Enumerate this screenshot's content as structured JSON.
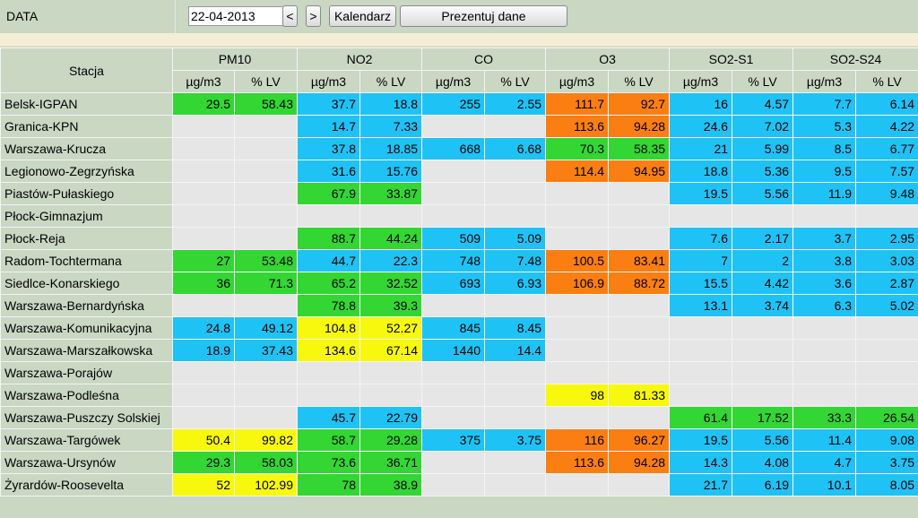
{
  "toolbar": {
    "date_label": "DATA",
    "date_value": "22-04-2013",
    "prev_label": "<",
    "next_label": ">",
    "calendar_label": "Kalendarz",
    "present_label": "Prezentuj dane"
  },
  "colors": {
    "green": "#33d633",
    "blue": "#1fc2f5",
    "yellow": "#f8f80f",
    "orange": "#fa7e12",
    "empty": "#e6e6e6",
    "header": "#c9d7c3"
  },
  "table": {
    "station_header": "Stacja",
    "pollutants": [
      "PM10",
      "NO2",
      "CO",
      "O3",
      "SO2-S1",
      "SO2-S24"
    ],
    "sub_headers": [
      "µg/m3",
      "% LV"
    ],
    "rows": [
      {
        "station": "Belsk-IGPAN",
        "cells": [
          [
            "29.5",
            "58.43",
            "green"
          ],
          [
            "37.7",
            "18.8",
            "blue"
          ],
          [
            "255",
            "2.55",
            "blue"
          ],
          [
            "111.7",
            "92.7",
            "orange"
          ],
          [
            "16",
            "4.57",
            "blue"
          ],
          [
            "7.7",
            "6.14",
            "blue"
          ]
        ]
      },
      {
        "station": "Granica-KPN",
        "cells": [
          [
            "",
            "",
            "empty"
          ],
          [
            "14.7",
            "7.33",
            "blue"
          ],
          [
            "",
            "",
            "empty"
          ],
          [
            "113.6",
            "94.28",
            "orange"
          ],
          [
            "24.6",
            "7.02",
            "blue"
          ],
          [
            "5.3",
            "4.22",
            "blue"
          ]
        ]
      },
      {
        "station": "Warszawa-Krucza",
        "cells": [
          [
            "",
            "",
            "empty"
          ],
          [
            "37.8",
            "18.85",
            "blue"
          ],
          [
            "668",
            "6.68",
            "blue"
          ],
          [
            "70.3",
            "58.35",
            "green"
          ],
          [
            "21",
            "5.99",
            "blue"
          ],
          [
            "8.5",
            "6.77",
            "blue"
          ]
        ]
      },
      {
        "station": "Legionowo-Zegrzyńska",
        "cells": [
          [
            "",
            "",
            "empty"
          ],
          [
            "31.6",
            "15.76",
            "blue"
          ],
          [
            "",
            "",
            "empty"
          ],
          [
            "114.4",
            "94.95",
            "orange"
          ],
          [
            "18.8",
            "5.36",
            "blue"
          ],
          [
            "9.5",
            "7.57",
            "blue"
          ]
        ]
      },
      {
        "station": "Piastów-Pułaskiego",
        "cells": [
          [
            "",
            "",
            "empty"
          ],
          [
            "67.9",
            "33.87",
            "green"
          ],
          [
            "",
            "",
            "empty"
          ],
          [
            "",
            "",
            "empty"
          ],
          [
            "19.5",
            "5.56",
            "blue"
          ],
          [
            "11.9",
            "9.48",
            "blue"
          ]
        ]
      },
      {
        "station": "Płock-Gimnazjum",
        "cells": [
          [
            "",
            "",
            "empty"
          ],
          [
            "",
            "",
            "empty"
          ],
          [
            "",
            "",
            "empty"
          ],
          [
            "",
            "",
            "empty"
          ],
          [
            "",
            "",
            "empty"
          ],
          [
            "",
            "",
            "empty"
          ]
        ]
      },
      {
        "station": "Płock-Reja",
        "cells": [
          [
            "",
            "",
            "empty"
          ],
          [
            "88.7",
            "44.24",
            "green"
          ],
          [
            "509",
            "5.09",
            "blue"
          ],
          [
            "",
            "",
            "empty"
          ],
          [
            "7.6",
            "2.17",
            "blue"
          ],
          [
            "3.7",
            "2.95",
            "blue"
          ]
        ]
      },
      {
        "station": "Radom-Tochtermana",
        "cells": [
          [
            "27",
            "53.48",
            "green"
          ],
          [
            "44.7",
            "22.3",
            "blue"
          ],
          [
            "748",
            "7.48",
            "blue"
          ],
          [
            "100.5",
            "83.41",
            "orange"
          ],
          [
            "7",
            "2",
            "blue"
          ],
          [
            "3.8",
            "3.03",
            "blue"
          ]
        ]
      },
      {
        "station": "Siedlce-Konarskiego",
        "cells": [
          [
            "36",
            "71.3",
            "green"
          ],
          [
            "65.2",
            "32.52",
            "green"
          ],
          [
            "693",
            "6.93",
            "blue"
          ],
          [
            "106.9",
            "88.72",
            "orange"
          ],
          [
            "15.5",
            "4.42",
            "blue"
          ],
          [
            "3.6",
            "2.87",
            "blue"
          ]
        ]
      },
      {
        "station": "Warszawa-Bernardyńska",
        "cells": [
          [
            "",
            "",
            "empty"
          ],
          [
            "78.8",
            "39.3",
            "green"
          ],
          [
            "",
            "",
            "empty"
          ],
          [
            "",
            "",
            "empty"
          ],
          [
            "13.1",
            "3.74",
            "blue"
          ],
          [
            "6.3",
            "5.02",
            "blue"
          ]
        ]
      },
      {
        "station": "Warszawa-Komunikacyjna",
        "cells": [
          [
            "24.8",
            "49.12",
            "blue"
          ],
          [
            "104.8",
            "52.27",
            "yellow"
          ],
          [
            "845",
            "8.45",
            "blue"
          ],
          [
            "",
            "",
            "empty"
          ],
          [
            "",
            "",
            "empty"
          ],
          [
            "",
            "",
            "empty"
          ]
        ]
      },
      {
        "station": "Warszawa-Marszałkowska",
        "cells": [
          [
            "18.9",
            "37.43",
            "blue"
          ],
          [
            "134.6",
            "67.14",
            "yellow"
          ],
          [
            "1440",
            "14.4",
            "blue"
          ],
          [
            "",
            "",
            "empty"
          ],
          [
            "",
            "",
            "empty"
          ],
          [
            "",
            "",
            "empty"
          ]
        ]
      },
      {
        "station": "Warszawa-Porajów",
        "cells": [
          [
            "",
            "",
            "empty"
          ],
          [
            "",
            "",
            "empty"
          ],
          [
            "",
            "",
            "empty"
          ],
          [
            "",
            "",
            "empty"
          ],
          [
            "",
            "",
            "empty"
          ],
          [
            "",
            "",
            "empty"
          ]
        ]
      },
      {
        "station": "Warszawa-Podleśna",
        "cells": [
          [
            "",
            "",
            "empty"
          ],
          [
            "",
            "",
            "empty"
          ],
          [
            "",
            "",
            "empty"
          ],
          [
            "98",
            "81.33",
            "yellow"
          ],
          [
            "",
            "",
            "empty"
          ],
          [
            "",
            "",
            "empty"
          ]
        ]
      },
      {
        "station": "Warszawa-Puszczy Solskiej",
        "cells": [
          [
            "",
            "",
            "empty"
          ],
          [
            "45.7",
            "22.79",
            "blue"
          ],
          [
            "",
            "",
            "empty"
          ],
          [
            "",
            "",
            "empty"
          ],
          [
            "61.4",
            "17.52",
            "green"
          ],
          [
            "33.3",
            "26.54",
            "green"
          ]
        ]
      },
      {
        "station": "Warszawa-Targówek",
        "cells": [
          [
            "50.4",
            "99.82",
            "yellow"
          ],
          [
            "58.7",
            "29.28",
            "green"
          ],
          [
            "375",
            "3.75",
            "blue"
          ],
          [
            "116",
            "96.27",
            "orange"
          ],
          [
            "19.5",
            "5.56",
            "blue"
          ],
          [
            "11.4",
            "9.08",
            "blue"
          ]
        ]
      },
      {
        "station": "Warszawa-Ursynów",
        "cells": [
          [
            "29.3",
            "58.03",
            "green"
          ],
          [
            "73.6",
            "36.71",
            "green"
          ],
          [
            "",
            "",
            "empty"
          ],
          [
            "113.6",
            "94.28",
            "orange"
          ],
          [
            "14.3",
            "4.08",
            "blue"
          ],
          [
            "4.7",
            "3.75",
            "blue"
          ]
        ]
      },
      {
        "station": "Żyrardów-Roosevelta",
        "cells": [
          [
            "52",
            "102.99",
            "yellow"
          ],
          [
            "78",
            "38.9",
            "green"
          ],
          [
            "",
            "",
            "empty"
          ],
          [
            "",
            "",
            "empty"
          ],
          [
            "21.7",
            "6.19",
            "blue"
          ],
          [
            "10.1",
            "8.05",
            "blue"
          ]
        ]
      }
    ]
  }
}
